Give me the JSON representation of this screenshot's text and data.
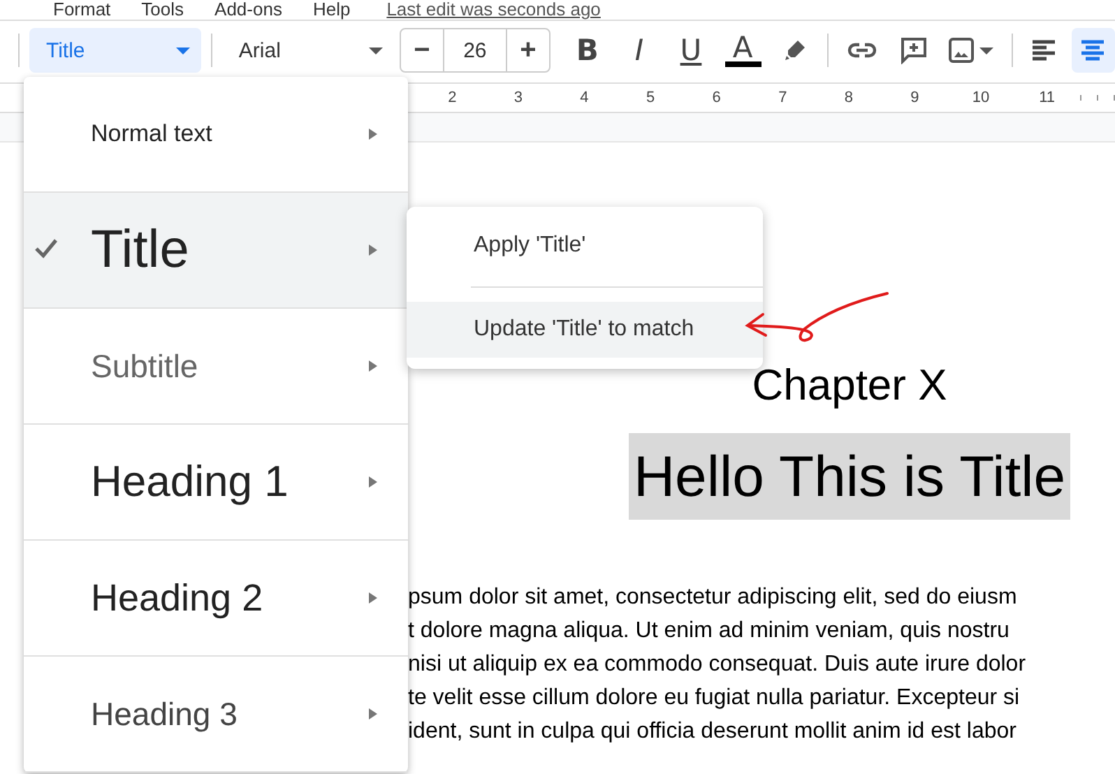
{
  "menu_bar": {
    "items": [
      "Format",
      "Tools",
      "Add-ons",
      "Help"
    ],
    "last_edit": "Last edit was seconds ago"
  },
  "toolbar": {
    "style_select": "Title",
    "font_select": "Arial",
    "size_buttons": [
      "−",
      "+"
    ],
    "font_size": "26",
    "format_buttons": [
      {
        "kind": "bold",
        "label": "B"
      },
      {
        "kind": "italic",
        "label": "I"
      },
      {
        "kind": "underline",
        "label": "U"
      },
      {
        "kind": "text_color",
        "label": "A"
      }
    ],
    "align_buttons": [
      {
        "kind": "left",
        "selected": false
      },
      {
        "kind": "center",
        "selected": true
      }
    ]
  },
  "ruler_labels": [
    "2",
    "3",
    "4",
    "5",
    "6",
    "7",
    "8",
    "9",
    "10",
    "11"
  ],
  "document": {
    "heading": "Chapter X",
    "title": "Hello This is Title",
    "title_highlighted": true,
    "paragraph_lines": [
      "psum dolor sit amet, consectetur adipiscing elit, sed do eiusm",
      "t dolore magna aliqua. Ut enim ad minim veniam, quis nostru",
      "nisi ut aliquip ex ea commodo consequat. Duis aute irure dolor",
      "te velit esse cillum dolore eu fugiat nulla pariatur. Excepteur si",
      "ident, sunt in culpa qui officia deserunt mollit anim id est labor"
    ]
  },
  "style_menu": [
    {
      "kind": "normal",
      "label": "Normal text",
      "selected": false
    },
    {
      "kind": "title",
      "label": "Title",
      "selected": true
    },
    {
      "kind": "subtitle",
      "label": "Subtitle",
      "selected": false
    },
    {
      "kind": "heading1",
      "label": "Heading 1",
      "selected": false
    },
    {
      "kind": "heading2",
      "label": "Heading 2",
      "selected": false
    },
    {
      "kind": "heading3",
      "label": "Heading 3",
      "selected": false
    }
  ],
  "submenu": [
    {
      "label": "Apply 'Title'",
      "highlighted": false
    },
    {
      "label": "Update 'Title' to match",
      "highlighted": true
    }
  ]
}
